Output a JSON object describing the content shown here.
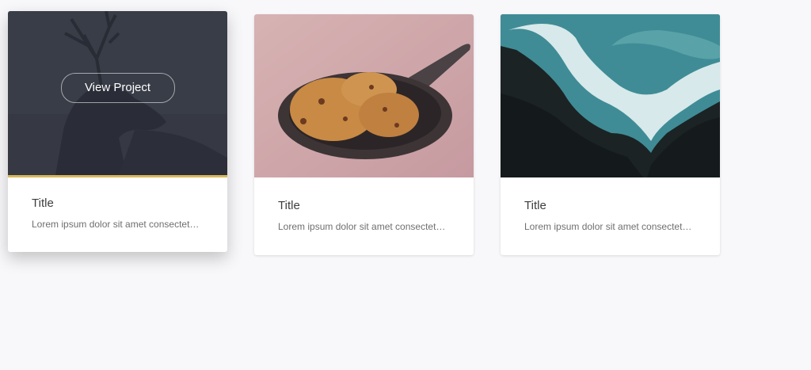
{
  "cards": [
    {
      "image": "deer-silhouette-photo",
      "hovered": true,
      "button_label": "View Project",
      "title": "Title",
      "description": "Lorem ipsum dolor sit amet consectetur adipiscing elit"
    },
    {
      "image": "cookies-in-skillet-photo",
      "hovered": false,
      "title": "Title",
      "description": "Lorem ipsum dolor sit amet consectetur adipiscing elit"
    },
    {
      "image": "ocean-waves-on-rocks-photo",
      "hovered": false,
      "title": "Title",
      "description": "Lorem ipsum dolor sit amet consectetur adipiscing elit"
    }
  ],
  "colors": {
    "page_bg": "#f8f8fa",
    "overlay": "#2b2f3a",
    "accent": "#d8b85a"
  }
}
